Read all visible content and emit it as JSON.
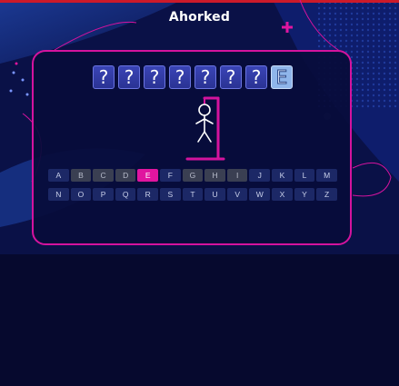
{
  "header": {
    "title": "Ahorked"
  },
  "word": {
    "tiles": [
      {
        "char": "?",
        "revealed": false
      },
      {
        "char": "?",
        "revealed": false
      },
      {
        "char": "?",
        "revealed": false
      },
      {
        "char": "?",
        "revealed": false
      },
      {
        "char": "?",
        "revealed": false
      },
      {
        "char": "?",
        "revealed": false
      },
      {
        "char": "?",
        "revealed": false
      },
      {
        "char": "E",
        "revealed": true
      }
    ]
  },
  "keyboard": {
    "rows": [
      [
        {
          "letter": "A",
          "state": "available"
        },
        {
          "letter": "B",
          "state": "used"
        },
        {
          "letter": "C",
          "state": "used"
        },
        {
          "letter": "D",
          "state": "used"
        },
        {
          "letter": "E",
          "state": "correct"
        },
        {
          "letter": "F",
          "state": "available"
        },
        {
          "letter": "G",
          "state": "used"
        },
        {
          "letter": "H",
          "state": "used"
        },
        {
          "letter": "I",
          "state": "used"
        },
        {
          "letter": "J",
          "state": "available"
        },
        {
          "letter": "K",
          "state": "available"
        },
        {
          "letter": "L",
          "state": "available"
        },
        {
          "letter": "M",
          "state": "available"
        }
      ],
      [
        {
          "letter": "N",
          "state": "available"
        },
        {
          "letter": "O",
          "state": "available"
        },
        {
          "letter": "P",
          "state": "available"
        },
        {
          "letter": "Q",
          "state": "available"
        },
        {
          "letter": "R",
          "state": "available"
        },
        {
          "letter": "S",
          "state": "available"
        },
        {
          "letter": "T",
          "state": "available"
        },
        {
          "letter": "U",
          "state": "available"
        },
        {
          "letter": "V",
          "state": "available"
        },
        {
          "letter": "W",
          "state": "available"
        },
        {
          "letter": "X",
          "state": "available"
        },
        {
          "letter": "Y",
          "state": "available"
        },
        {
          "letter": "Z",
          "state": "available"
        }
      ]
    ]
  },
  "hangman": {
    "wrong_guesses": 6,
    "max_wrong": 6
  },
  "colors": {
    "accent": "#d4139e",
    "background": "#070a33",
    "tile": "#2f3aa3",
    "tile_revealed": "#8fb5ea",
    "key": "#1c2866",
    "key_used": "#3a3f52",
    "key_correct": "#e0159f"
  }
}
